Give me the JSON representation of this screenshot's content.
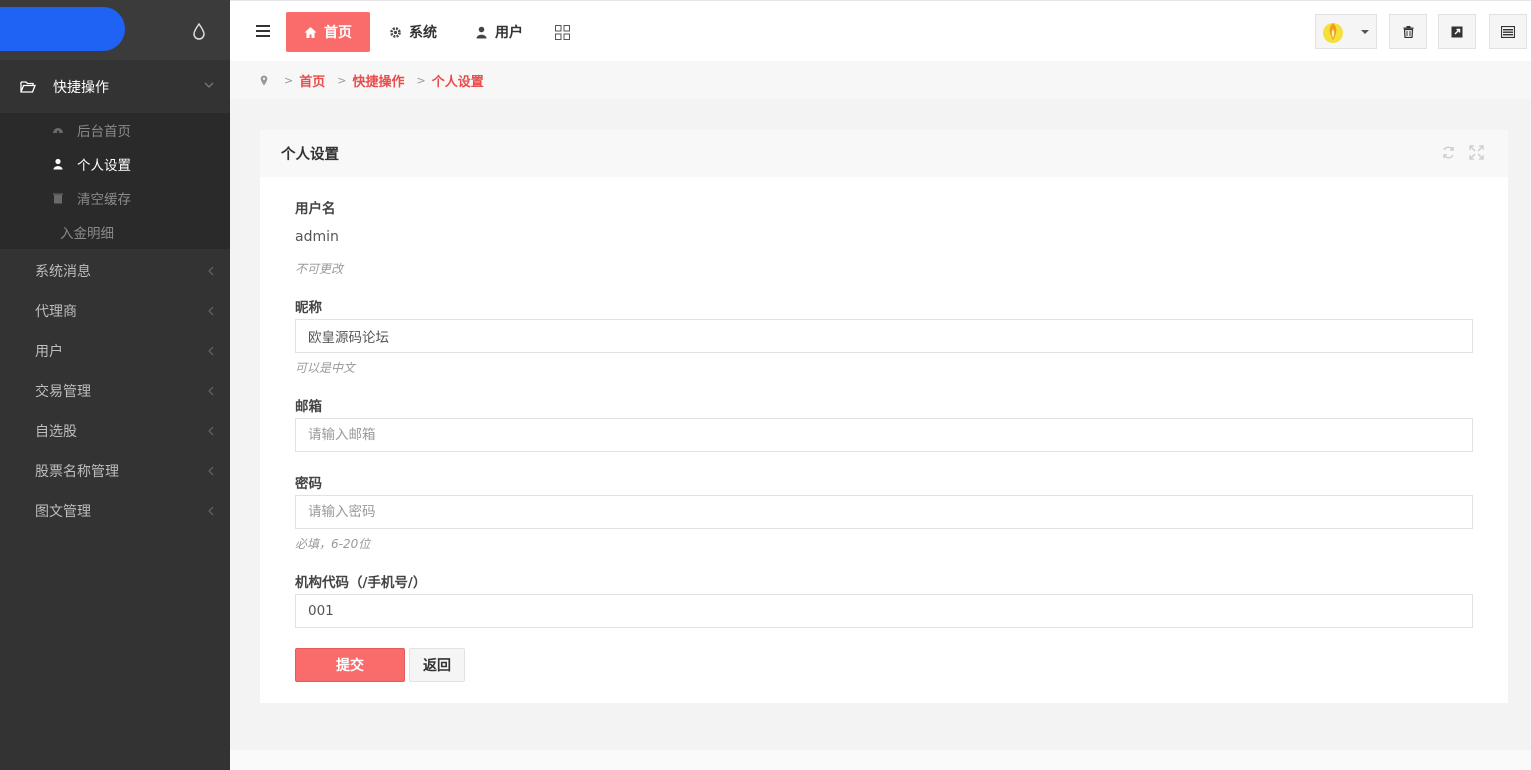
{
  "colors": {
    "accent": "#fa6b6b",
    "logo": "#1f63f5",
    "sidebar": "#333333"
  },
  "sidebar": {
    "group": {
      "label": "快捷操作",
      "items": [
        {
          "label": "后台首页",
          "icon": "dashboard-icon"
        },
        {
          "label": "个人设置",
          "icon": "user-icon",
          "active": true
        },
        {
          "label": "清空缓存",
          "icon": "trash-icon"
        },
        {
          "label": "入金明细",
          "icon": ""
        }
      ]
    },
    "items": [
      {
        "label": "系统消息"
      },
      {
        "label": "代理商"
      },
      {
        "label": "用户"
      },
      {
        "label": "交易管理"
      },
      {
        "label": "自选股"
      },
      {
        "label": "股票名称管理"
      },
      {
        "label": "图文管理"
      }
    ]
  },
  "topnav": {
    "tabs": [
      {
        "label": "首页",
        "icon": "home-icon"
      },
      {
        "label": "系统",
        "icon": "gear-icon"
      },
      {
        "label": "用户",
        "icon": "user-icon"
      }
    ]
  },
  "breadcrumb": {
    "items": [
      "首页",
      "快捷操作",
      "个人设置"
    ]
  },
  "panel": {
    "title": "个人设置",
    "fields": {
      "username": {
        "label": "用户名",
        "value": "admin",
        "help": "不可更改"
      },
      "nickname": {
        "label": "昵称",
        "value": "欧皇源码论坛",
        "help": "可以是中文"
      },
      "email": {
        "label": "邮箱",
        "placeholder": "请输入邮箱"
      },
      "password": {
        "label": "密码",
        "placeholder": "请输入密码",
        "help": "必填，6-20位"
      },
      "orgcode": {
        "label": "机构代码（/手机号/）",
        "value": "001"
      }
    },
    "buttons": {
      "submit": "提交",
      "back": "返回"
    }
  }
}
